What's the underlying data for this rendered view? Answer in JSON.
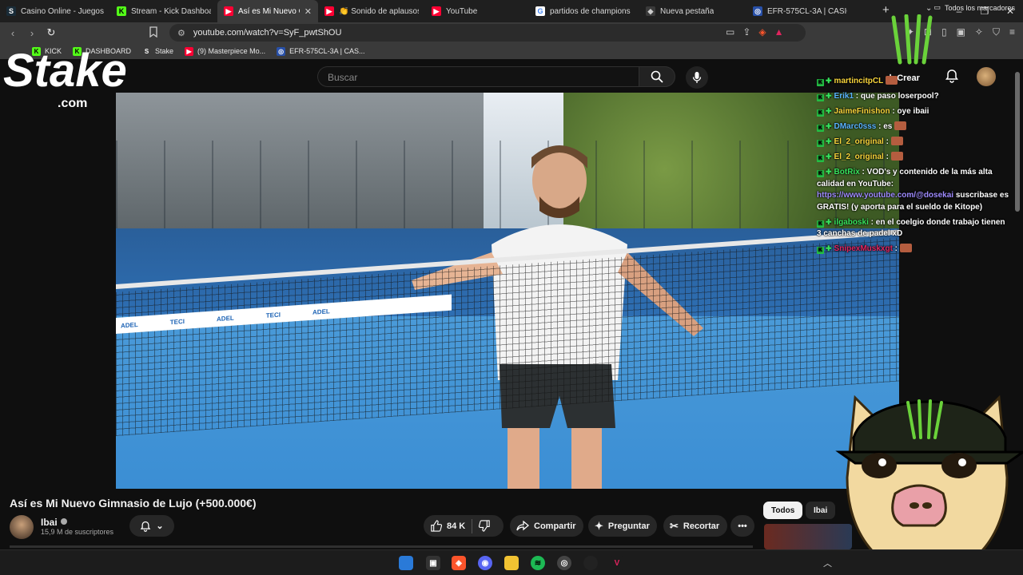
{
  "browser": {
    "tabs": [
      {
        "label": "Casino Online - Juegos d",
        "fav": "S",
        "color": "#1a2c38",
        "text": "#ffffff"
      },
      {
        "label": "Stream - Kick Dashboard",
        "fav": "K",
        "color": "#53fc18",
        "text": "#000000"
      },
      {
        "label": "Así es Mi Nuevo G",
        "fav": "▶",
        "color": "#ff0033",
        "text": "#ffffff"
      },
      {
        "label": "👏 Sonido de aplausos y",
        "fav": "▶",
        "color": "#ff0033",
        "text": "#ffffff"
      },
      {
        "label": "YouTube",
        "fav": "▶",
        "color": "#ff0033",
        "text": "#ffffff"
      },
      {
        "label": "partidos de champions le",
        "fav": "G",
        "color": "#ffffff",
        "text": "#4285f4"
      },
      {
        "label": "Nueva pestaña",
        "fav": "◆",
        "color": "#3a3a3a",
        "text": "#cccccc"
      },
      {
        "label": "EFR-575CL-3A | CASIO",
        "fav": "◎",
        "color": "#2850a8",
        "text": "#ffffff"
      }
    ],
    "url": "youtube.com/watch?v=SyF_pwtShOU",
    "bookmarks": [
      {
        "label": "KICK",
        "fav": "K",
        "color": "#53fc18",
        "text": "#000"
      },
      {
        "label": "DASHBOARD",
        "fav": "K",
        "color": "#53fc18",
        "text": "#000"
      },
      {
        "label": "Stake",
        "fav": "S",
        "color": "#3a3a3a",
        "text": "#fff"
      },
      {
        "label": "(9) Masterpiece Mo...",
        "fav": "▶",
        "color": "#ff0033",
        "text": "#fff"
      },
      {
        "label": "EFR-575CL-3A | CAS...",
        "fav": "◎",
        "color": "#2850a8",
        "text": "#fff"
      }
    ],
    "all_bookmarks": "Todos los marcadores"
  },
  "youtube": {
    "search_placeholder": "Buscar",
    "create_label": "Crear",
    "video_title": "Así es Mi Nuevo Gimnasio de Lujo (+500.000€)",
    "channel_name": "Ibai",
    "subscribers": "15,9 M de suscriptores",
    "likes": "84 K",
    "share": "Compartir",
    "ask": "Preguntar",
    "clip": "Recortar",
    "filter_all": "Todos",
    "filter_ibai": "Ibai"
  },
  "chat": [
    {
      "user": "martincitpCL",
      "color": "#f6d33b",
      "msg": "",
      "emote": true,
      "link": ""
    },
    {
      "user": "Erik1",
      "color": "#5ab4ff",
      "msg": ": que paso loserpool?",
      "emote": false,
      "link": ""
    },
    {
      "user": "JaimeFinishon",
      "color": "#f6d33b",
      "msg": ": oye ibaii",
      "emote": false,
      "link": ""
    },
    {
      "user": "DMarc0sss",
      "color": "#5ab4ff",
      "msg": ": es",
      "emote": true,
      "link": ""
    },
    {
      "user": "El_2_original",
      "color": "#f6d33b",
      "msg": ":",
      "emote": true,
      "link": ""
    },
    {
      "user": "El_2_original",
      "color": "#f6d33b",
      "msg": ":",
      "emote": true,
      "link": ""
    },
    {
      "user": "BotRix",
      "color": "#37e25c",
      "msg": ": VOD's y contenido de la más alta calidad en YouTube:",
      "emote": false,
      "link": "https://www.youtube.com/@dosekai",
      "tail": " suscribase es GRATIS! (y aporta para el sueldo de Kitope)"
    },
    {
      "user": "ilgaboski",
      "color": "#37e25c",
      "msg": ": en el coelgio donde trabajo tienen 3 canchas de padel xD",
      "emote": false,
      "link": ""
    },
    {
      "user": "SnipexMuskxgt",
      "color": "#e0245e",
      "msg": ":",
      "emote": true,
      "link": ""
    }
  ],
  "overlays": {
    "stake_logo": "Stake",
    "stake_sub": ".com"
  },
  "video_signage": [
    "ADEL",
    "TECI",
    "ADEL",
    "TECI",
    "ADEL"
  ]
}
